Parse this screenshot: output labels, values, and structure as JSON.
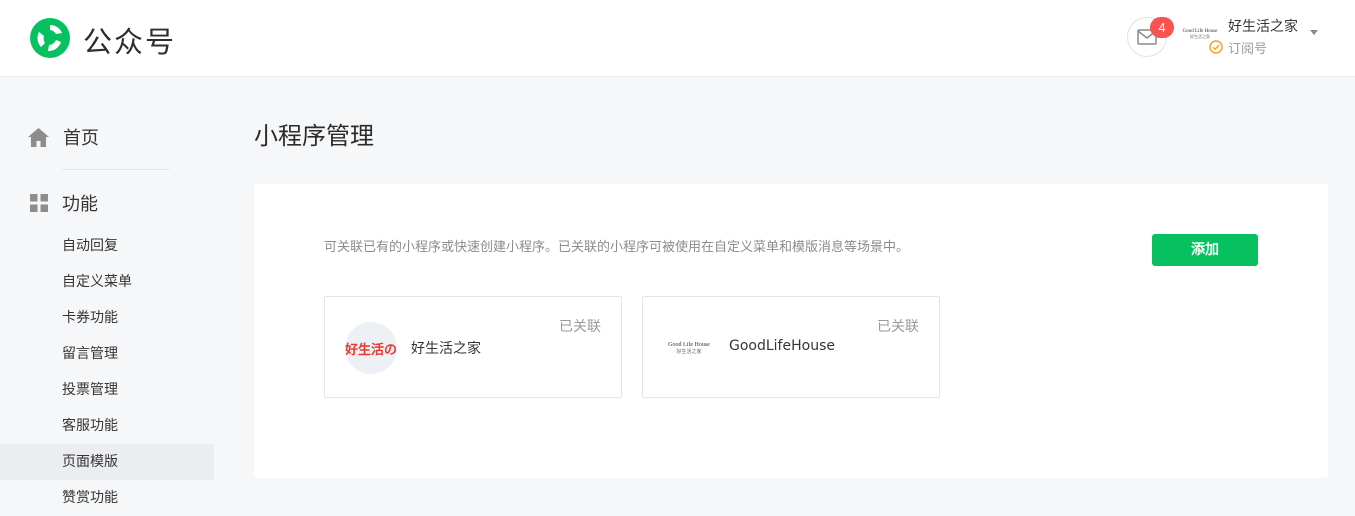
{
  "header": {
    "app_title": "公众号",
    "notification_count": "4",
    "account_avatar_text": "Good Life House",
    "account_avatar_subtext": "好生活之家",
    "account_name": "好生活之家",
    "account_type": "订阅号"
  },
  "sidebar": {
    "home_label": "首页",
    "function_label": "功能",
    "items": [
      {
        "label": "自动回复"
      },
      {
        "label": "自定义菜单"
      },
      {
        "label": "卡券功能"
      },
      {
        "label": "留言管理"
      },
      {
        "label": "投票管理"
      },
      {
        "label": "客服功能"
      },
      {
        "label": "页面模版",
        "active": true
      },
      {
        "label": "赞赏功能"
      }
    ]
  },
  "main": {
    "page_title": "小程序管理",
    "description": "可关联已有的小程序或快速创建小程序。已关联的小程序可被使用在自定义菜单和模版消息等场景中。",
    "add_button_label": "添加",
    "cards": [
      {
        "logo_text": "好生活の",
        "name": "好生活之家",
        "status": "已关联"
      },
      {
        "logo_text": "Good Life House",
        "logo_subtext": "好生活之家",
        "name": "GoodLifeHouse",
        "status": "已关联"
      }
    ]
  },
  "colors": {
    "brand_green": "#07c160",
    "badge_red": "#fa5151",
    "verified_orange": "#f0a020"
  }
}
